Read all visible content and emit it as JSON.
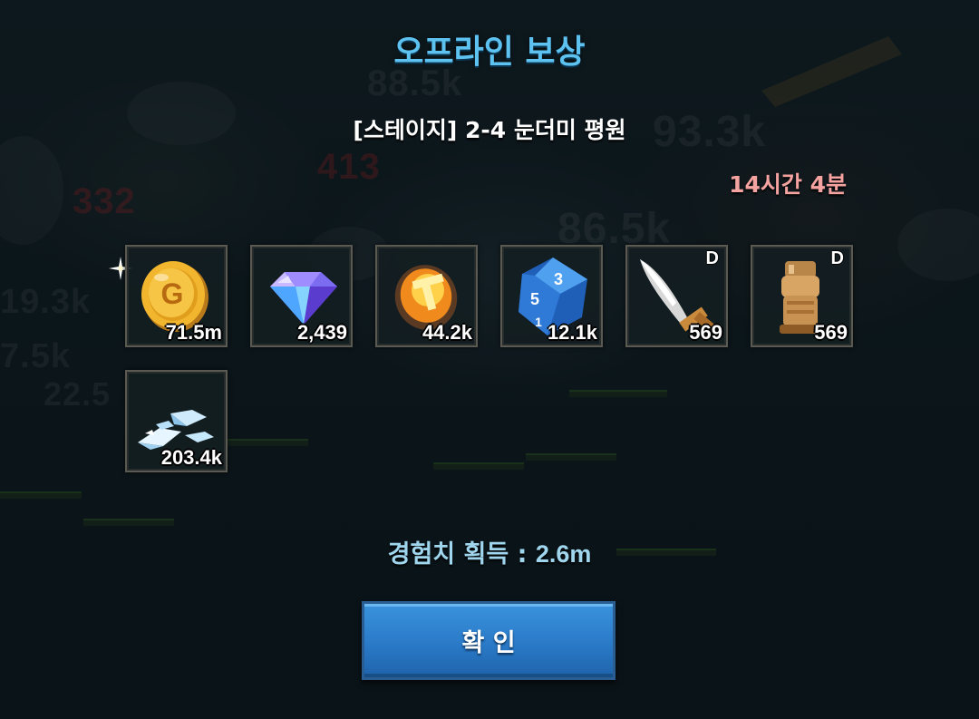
{
  "popup": {
    "title": "오프라인 보상",
    "stage_name": "[스테이지] 2-4 눈더미 평원",
    "offline_time": "14시간 4분",
    "exp_label": "경험치 획득 : ",
    "exp_value": "2.6m",
    "confirm_label": "확 인"
  },
  "rewards": [
    {
      "icon": "gold-coin-icon",
      "count": "71.5m",
      "grade": ""
    },
    {
      "icon": "diamond-gem-icon",
      "count": "2,439",
      "grade": ""
    },
    {
      "icon": "amber-rune-stone-icon",
      "count": "44.2k",
      "grade": ""
    },
    {
      "icon": "blue-dice-icon",
      "count": "12.1k",
      "grade": ""
    },
    {
      "icon": "sword-blade-icon",
      "count": "569",
      "grade": "D"
    },
    {
      "icon": "gauntlet-armor-icon",
      "count": "569",
      "grade": "D"
    },
    {
      "icon": "ice-crystal-shards-icon",
      "count": "203.4k",
      "grade": ""
    }
  ],
  "background_numbers": [
    "88.5k",
    "93.3k",
    "413",
    "332",
    "86.5k",
    "19.3k",
    "7.5k",
    "22.5"
  ],
  "colors": {
    "title": "#5ec2f0",
    "time": "#f4a3a0",
    "exp": "#9fd6ee",
    "button": "#2a7ac8"
  }
}
